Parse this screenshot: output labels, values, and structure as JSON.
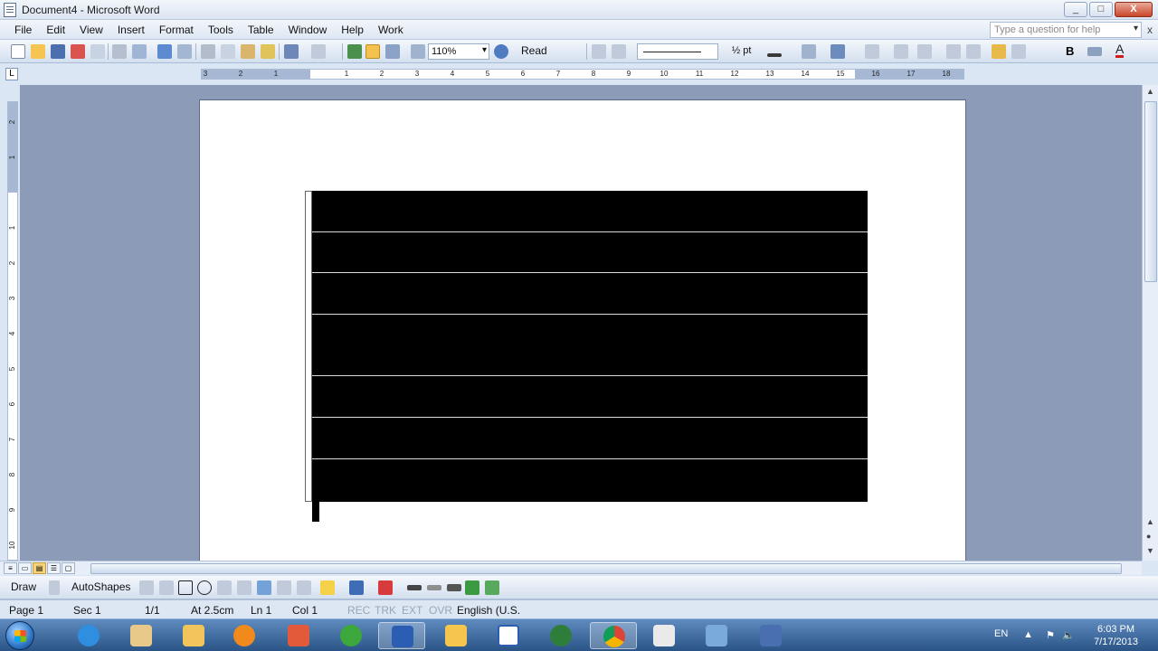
{
  "window": {
    "title": "Document4 - Microsoft Word",
    "min": "_",
    "max": "□",
    "close": "X"
  },
  "menu": {
    "items": [
      "File",
      "Edit",
      "View",
      "Insert",
      "Format",
      "Tools",
      "Table",
      "Window",
      "Help",
      "Work"
    ],
    "help_placeholder": "Type a question for help",
    "close": "x"
  },
  "toolbar": {
    "zoom": "110%",
    "read_label": "Read",
    "line_weight": "½ pt",
    "bold": "B",
    "font_color": "A"
  },
  "ruler": {
    "ticks": [
      "3",
      "2",
      "1",
      "1",
      "2",
      "3",
      "4",
      "5",
      "6",
      "7",
      "8",
      "9",
      "10",
      "11",
      "12",
      "13",
      "14",
      "15",
      "16",
      "17",
      "18"
    ],
    "tab_selector": "L"
  },
  "vruler": {
    "ticks": [
      "2",
      "1",
      "1",
      "2",
      "3",
      "4",
      "5",
      "6",
      "7",
      "8",
      "9",
      "10"
    ]
  },
  "drawbar": {
    "draw": "Draw",
    "autoshapes": "AutoShapes"
  },
  "status": {
    "page": "Page 1",
    "sec": "Sec 1",
    "pages": "1/1",
    "at": "At 2.5cm",
    "ln": "Ln 1",
    "col": "Col 1",
    "rec": "REC",
    "trk": "TRK",
    "ext": "EXT",
    "ovr": "OVR",
    "lang": "English (U.S."
  },
  "taskbar": {
    "lang": "EN",
    "time": "6:03 PM",
    "date": "7/17/2013",
    "apps": [
      "ie-icon",
      "paint-icon",
      "explorer-icon",
      "media-player-icon",
      "puzzle-icon",
      "refresh-icon",
      "word-icon",
      "photo-icon",
      "word-doc-icon",
      "network-icon",
      "chrome-icon",
      "document-icon",
      "screen-icon",
      "film-icon"
    ]
  }
}
